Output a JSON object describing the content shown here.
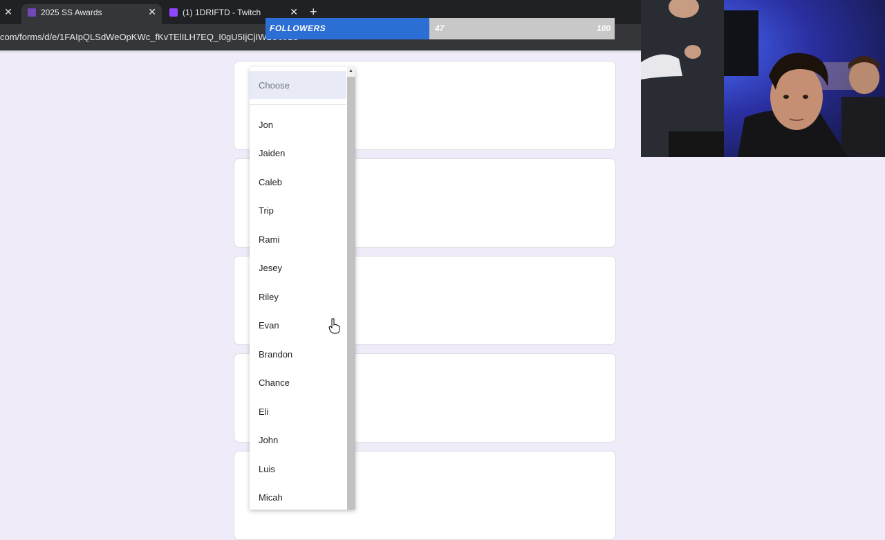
{
  "browser": {
    "close_glyph": "✕",
    "tabs": [
      {
        "title": "2025 SS Awards",
        "close": "✕"
      },
      {
        "title": "(1) 1DRIFTD - Twitch",
        "close": "✕"
      }
    ],
    "new_tab": "+",
    "url": "com/forms/d/e/1FAIpQLSdWeOpKWc_fKvTElILH7EQ_I0gU5IjCjIW1Uc0LS"
  },
  "followers_overlay": {
    "label": "FOLLOWERS",
    "current": "47",
    "goal": "100",
    "progress_fraction": 0.47,
    "fill_color": "#2b6fd4"
  },
  "dropdown": {
    "placeholder": "Choose",
    "options": [
      "Jon",
      "Jaiden",
      "Caleb",
      "Trip",
      "Rami",
      "Jesey",
      "Riley",
      "Evan",
      "Brandon",
      "Chance",
      "Eli",
      "John",
      "Luis",
      "Micah"
    ]
  },
  "colors": {
    "page_bg": "#f0ebf8",
    "chrome_dark": "#202124",
    "form_accent": "#7248b9"
  }
}
